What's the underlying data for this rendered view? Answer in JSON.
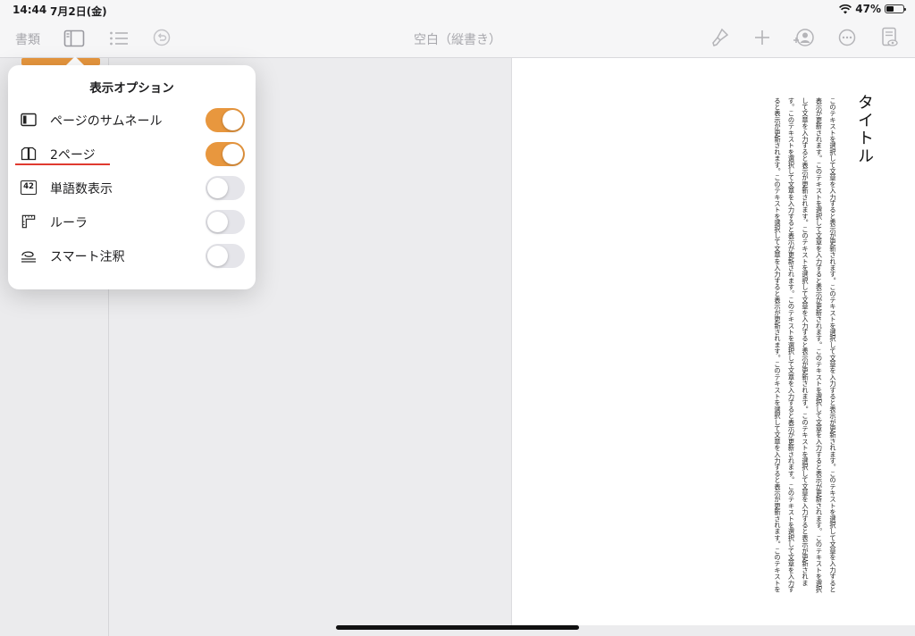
{
  "status": {
    "time": "14:44",
    "date": "7月2日(金)",
    "battery": "47%",
    "battery_level": 0.47
  },
  "toolbar": {
    "documents_label": "書類",
    "title": "空白（縦書き）"
  },
  "popover": {
    "title": "表示オプション",
    "options": [
      {
        "label": "ページのサムネール",
        "icon": "sidebar-icon",
        "on": true
      },
      {
        "label": "2ページ",
        "icon": "two-page-icon",
        "on": true
      },
      {
        "label": "単語数表示",
        "icon": "word-count-icon",
        "icon_text": "42",
        "on": false
      },
      {
        "label": "ルーラ",
        "icon": "ruler-icon",
        "on": false
      },
      {
        "label": "スマート注釈",
        "icon": "smart-annotation-icon",
        "on": false
      }
    ]
  },
  "document": {
    "title": "タイトル",
    "body": "このテキストを選択して文章を入力すると表示が更新されます。このテキストを選択して文章を入力すると表示が更新されます。このテキストを選択して文章を入力すると表示が更新されます。このテキストを選択して文章を入力すると表示が更新されます。このテキストを選択して文章を入力すると表示が更新されます。このテキストを選択して文章を入力すると表示が更新されます。このテキストを選択して文章を入力すると表示が更新されます。このテキストを選択して文章を入力すると表示が更新されます。このテキストを選択して文章を入力すると表示が更新されます。このテキストを選択して文章を入力すると表示が更新されます。このテキストを選択して文章を入力すると表示が更新されます。このテキストを選択して文章を入力すると表示が更新されます。このテキストを選択して文章を入力すると表示が更新されます。このテキストを選択して文章を入力すると表示が更新されます。"
  },
  "colors": {
    "accent": "#e8973e",
    "toggle_off": "#e5e5ea",
    "annotation": "#e03a30"
  }
}
